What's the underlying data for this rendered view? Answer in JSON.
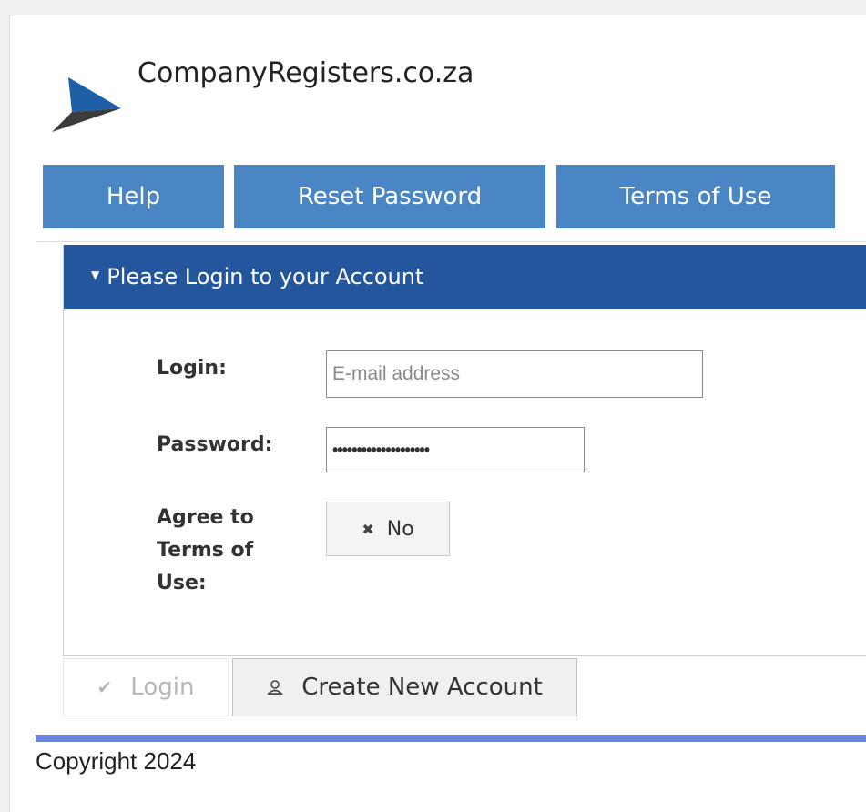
{
  "site": {
    "title": "CompanyRegisters.co.za"
  },
  "nav": {
    "items": [
      {
        "label": "Help"
      },
      {
        "label": "Reset Password"
      },
      {
        "label": "Terms of Use"
      }
    ]
  },
  "login_panel": {
    "header": "Please Login to your Account",
    "login_label": "Login:",
    "login_placeholder": "E-mail address",
    "login_value": "",
    "password_label": "Password:",
    "password_value": "••••••••••••••••••••",
    "agree_label_line1": "Agree to",
    "agree_label_line2": "Terms of",
    "agree_label_line3": "Use:",
    "agree_toggle_value": "No"
  },
  "actions": {
    "login_label": "Login",
    "create_account_label": "Create New Account"
  },
  "footer": {
    "copyright": "Copyright 2024"
  },
  "colors": {
    "nav_button": "#4a86c4",
    "panel_header": "#23569c",
    "footer_rule": "#6a86dc"
  },
  "icons": {
    "logo": "paper-plane-logo",
    "caret": "caret-down-icon",
    "toggle": "close-icon",
    "login": "checkmark-icon",
    "create": "user-icon"
  }
}
